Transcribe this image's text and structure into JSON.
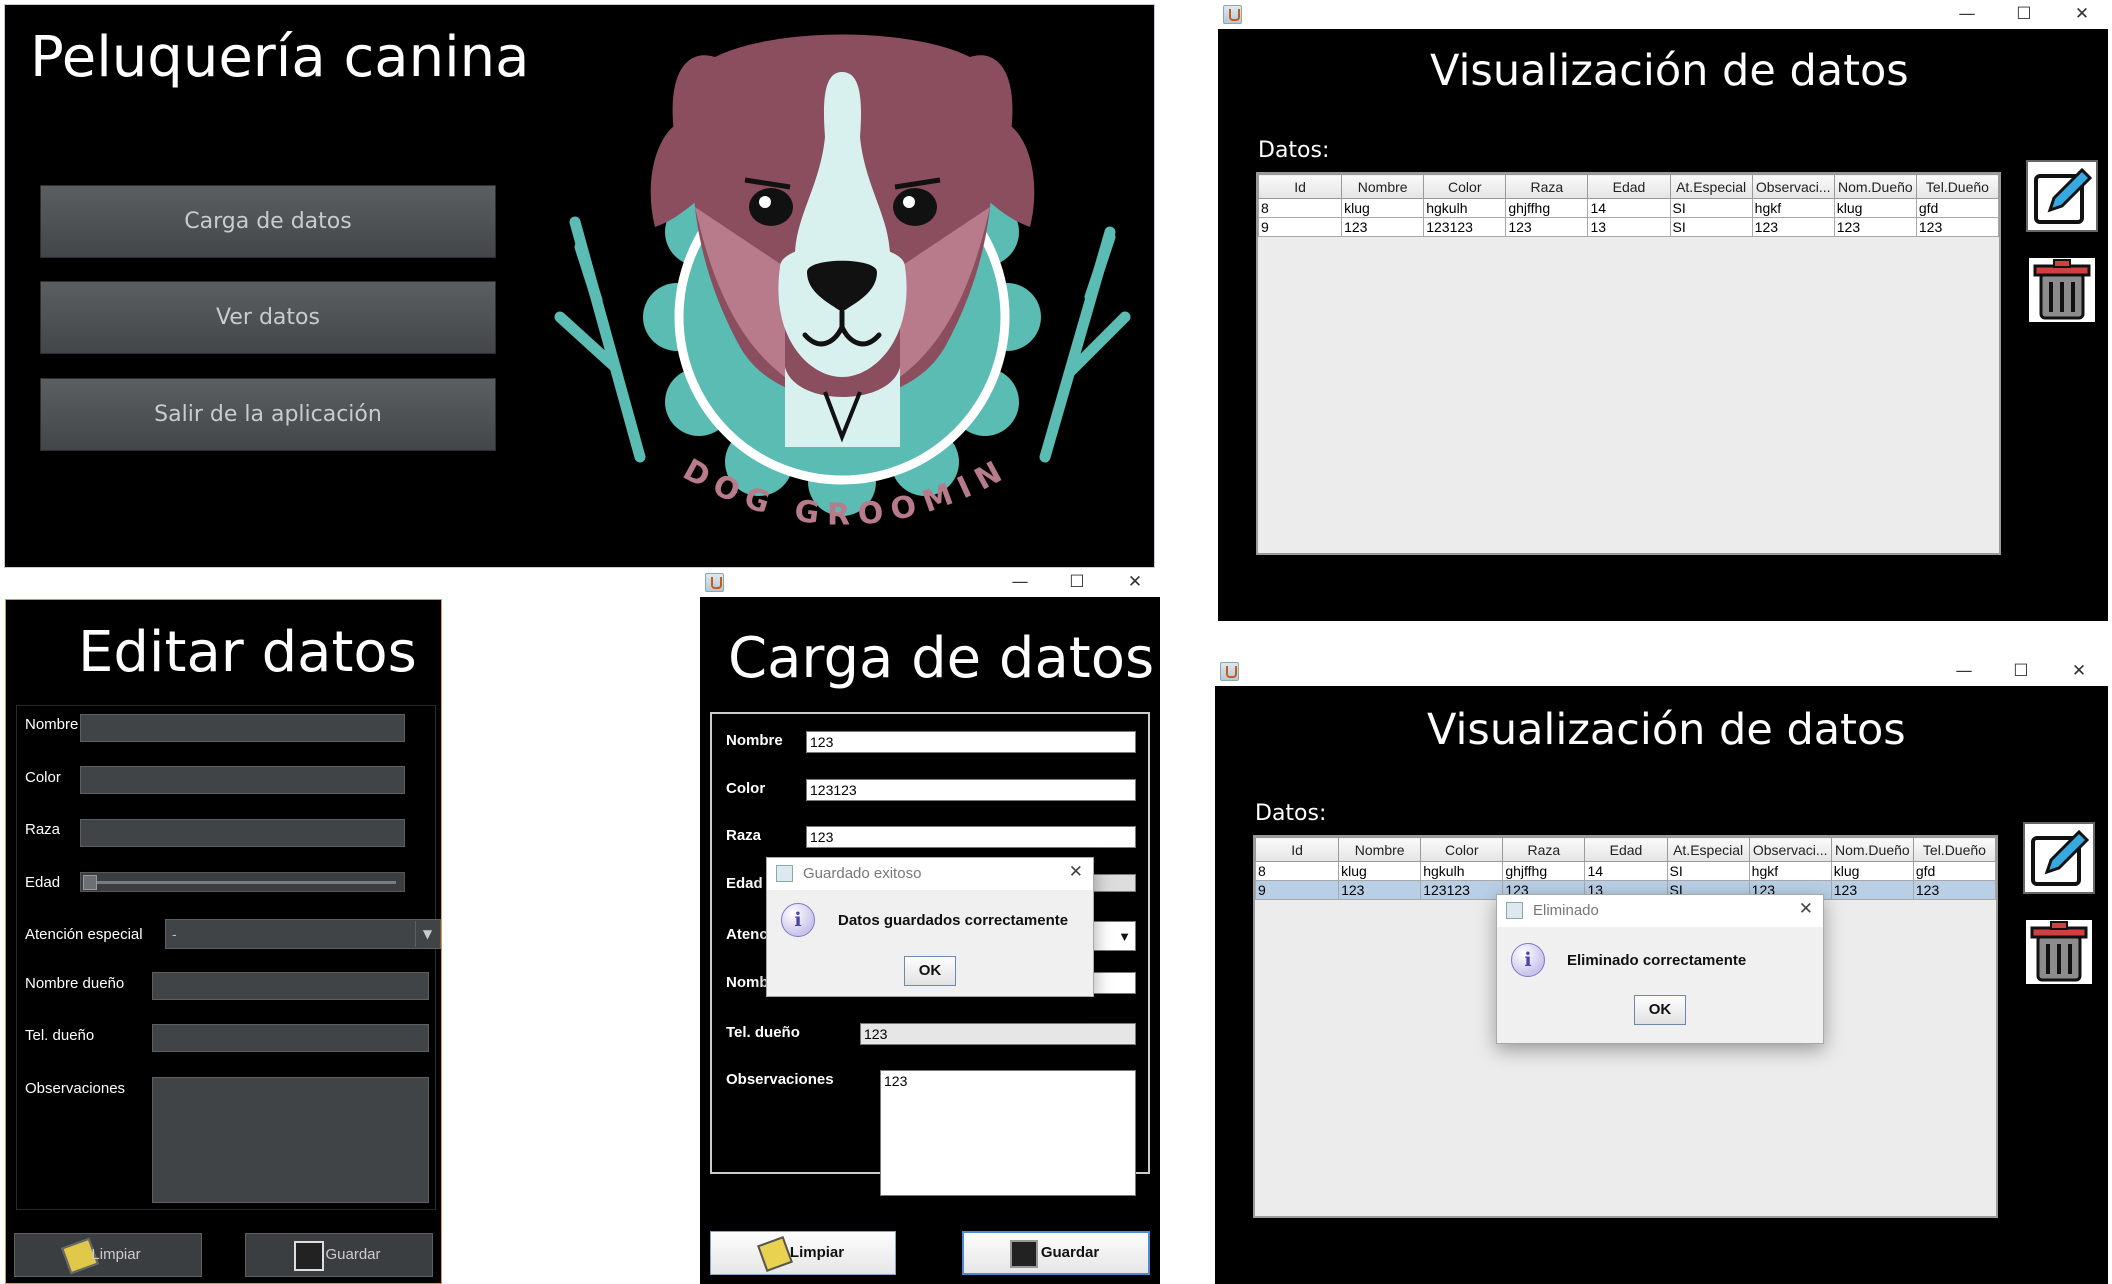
{
  "main": {
    "title": "Peluquería canina",
    "buttons": [
      "Carga de datos",
      "Ver datos",
      "Salir de la aplicación"
    ],
    "logo_text": "DOG GROOMING"
  },
  "editor": {
    "title": "Editar datos",
    "labels": {
      "nombre": "Nombre",
      "color": "Color",
      "raza": "Raza",
      "edad": "Edad",
      "atencion": "Atención especial",
      "dueno": "Nombre dueño",
      "tel": "Tel. dueño",
      "obs": "Observaciones"
    },
    "atencion_value": "-",
    "buttons": {
      "limpiar": "Limpiar",
      "guardar": "Guardar"
    }
  },
  "carga": {
    "title": "Carga de datos",
    "labels": {
      "nombre": "Nombre",
      "color": "Color",
      "raza": "Raza",
      "edad": "Edad",
      "atencion": "Atenc",
      "dueno": "Nomb",
      "tel": "Tel. dueño",
      "obs": "Observaciones"
    },
    "values": {
      "nombre": "123",
      "color": "123123",
      "raza": "123",
      "tel": "123",
      "obs": "123"
    },
    "buttons": {
      "limpiar": "Limpiar",
      "guardar": "Guardar"
    },
    "dialog": {
      "title": "Guardado exitoso",
      "message": "Datos guardados correctamente",
      "ok": "OK"
    }
  },
  "viz": {
    "title": "Visualización de datos",
    "datos_label": "Datos:",
    "columns": [
      "Id",
      "Nombre",
      "Color",
      "Raza",
      "Edad",
      "At.Especial",
      "Observaci...",
      "Nom.Dueño",
      "Tel.Dueño"
    ],
    "rows": [
      [
        "8",
        "klug",
        "hgkulh",
        "ghjffhg",
        "14",
        "SI",
        "hgkf",
        "klug",
        "gfd"
      ],
      [
        "9",
        "123",
        "123123",
        "123",
        "13",
        "SI",
        "123",
        "123",
        "123"
      ]
    ]
  },
  "viz2": {
    "dialog": {
      "title": "Eliminado",
      "message": "Eliminado correctamente",
      "ok": "OK"
    },
    "selected_row": 1
  },
  "window_buttons": {
    "minimize": "—",
    "maximize": "☐",
    "close": "✕"
  }
}
